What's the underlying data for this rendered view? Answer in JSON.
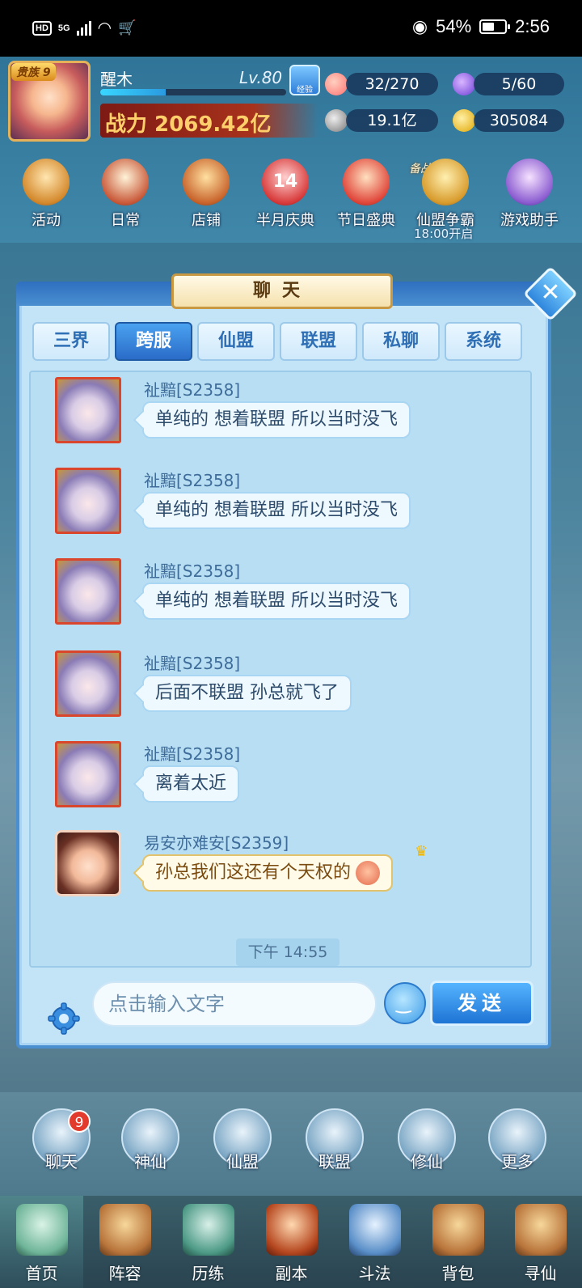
{
  "status_bar": {
    "hd": "HD",
    "network": "5G",
    "battery_text": "54%",
    "time": "2:56"
  },
  "player": {
    "vip": "贵族 9",
    "name": "醒木",
    "level": "Lv.80",
    "exp_button": "经验",
    "exp_progress": 0.35,
    "power": "战力 2069.42亿",
    "stamina": "32/270",
    "energy": "5/60",
    "copper": "19.1亿",
    "gold": "305084"
  },
  "activities": [
    {
      "label": "活动",
      "icon": "activity-icon"
    },
    {
      "label": "日常",
      "icon": "daily-scroll-icon"
    },
    {
      "label": "店铺",
      "icon": "shop-icon"
    },
    {
      "label": "半月庆典",
      "icon": "half-month-celebration-icon"
    },
    {
      "label": "节日盛典",
      "icon": "festival-gift-icon"
    },
    {
      "label": "仙盟争霸",
      "icon": "guild-war-icon"
    },
    {
      "label": "游戏助手",
      "icon": "game-assistant-icon"
    }
  ],
  "activity_prep": "备战中",
  "activity_note": "18:00开启",
  "celebration_badge": "14",
  "chat": {
    "title": "聊天",
    "tabs": [
      "三界",
      "跨服",
      "仙盟",
      "联盟",
      "私聊",
      "系统"
    ],
    "active_tab": "跨服",
    "messages": [
      {
        "sender": "祉黯[S2358]",
        "text": "单纯的 想着联盟 所以当时没飞"
      },
      {
        "sender": "祉黯[S2358]",
        "text": "单纯的 想着联盟 所以当时没飞"
      },
      {
        "sender": "祉黯[S2358]",
        "text": "单纯的 想着联盟 所以当时没飞"
      },
      {
        "sender": "祉黯[S2358]",
        "text": "后面不联盟  孙总就飞了"
      },
      {
        "sender": "祉黯[S2358]",
        "text": "离着太近"
      },
      {
        "sender": "易安亦难安[S2359]",
        "text": "孙总我们这还有个天权的"
      }
    ],
    "timestamp": "下午 14:55",
    "input_placeholder": "点击输入文字",
    "send_label": "发送"
  },
  "functions": [
    {
      "label": "聊天",
      "icon": "chat-icon"
    },
    {
      "label": "神仙",
      "icon": "immortal-icon"
    },
    {
      "label": "仙盟",
      "icon": "guild-icon"
    },
    {
      "label": "联盟",
      "icon": "alliance-icon"
    },
    {
      "label": "修仙",
      "icon": "cultivation-icon"
    },
    {
      "label": "更多",
      "icon": "more-icon"
    }
  ],
  "chat_badge": "9",
  "nav": [
    {
      "label": "首页",
      "icon": "home-icon"
    },
    {
      "label": "阵容",
      "icon": "lineup-icon"
    },
    {
      "label": "历练",
      "icon": "training-icon"
    },
    {
      "label": "副本",
      "icon": "dungeon-icon"
    },
    {
      "label": "斗法",
      "icon": "battle-icon"
    },
    {
      "label": "背包",
      "icon": "bag-icon"
    },
    {
      "label": "寻仙",
      "icon": "seek-immortal-icon"
    }
  ],
  "colors": {
    "panel_bg": "#c3e4f6",
    "panel_border": "#4a8fd0",
    "tab_active": "#2a6cc8",
    "power_text": "#ffcf6b"
  }
}
